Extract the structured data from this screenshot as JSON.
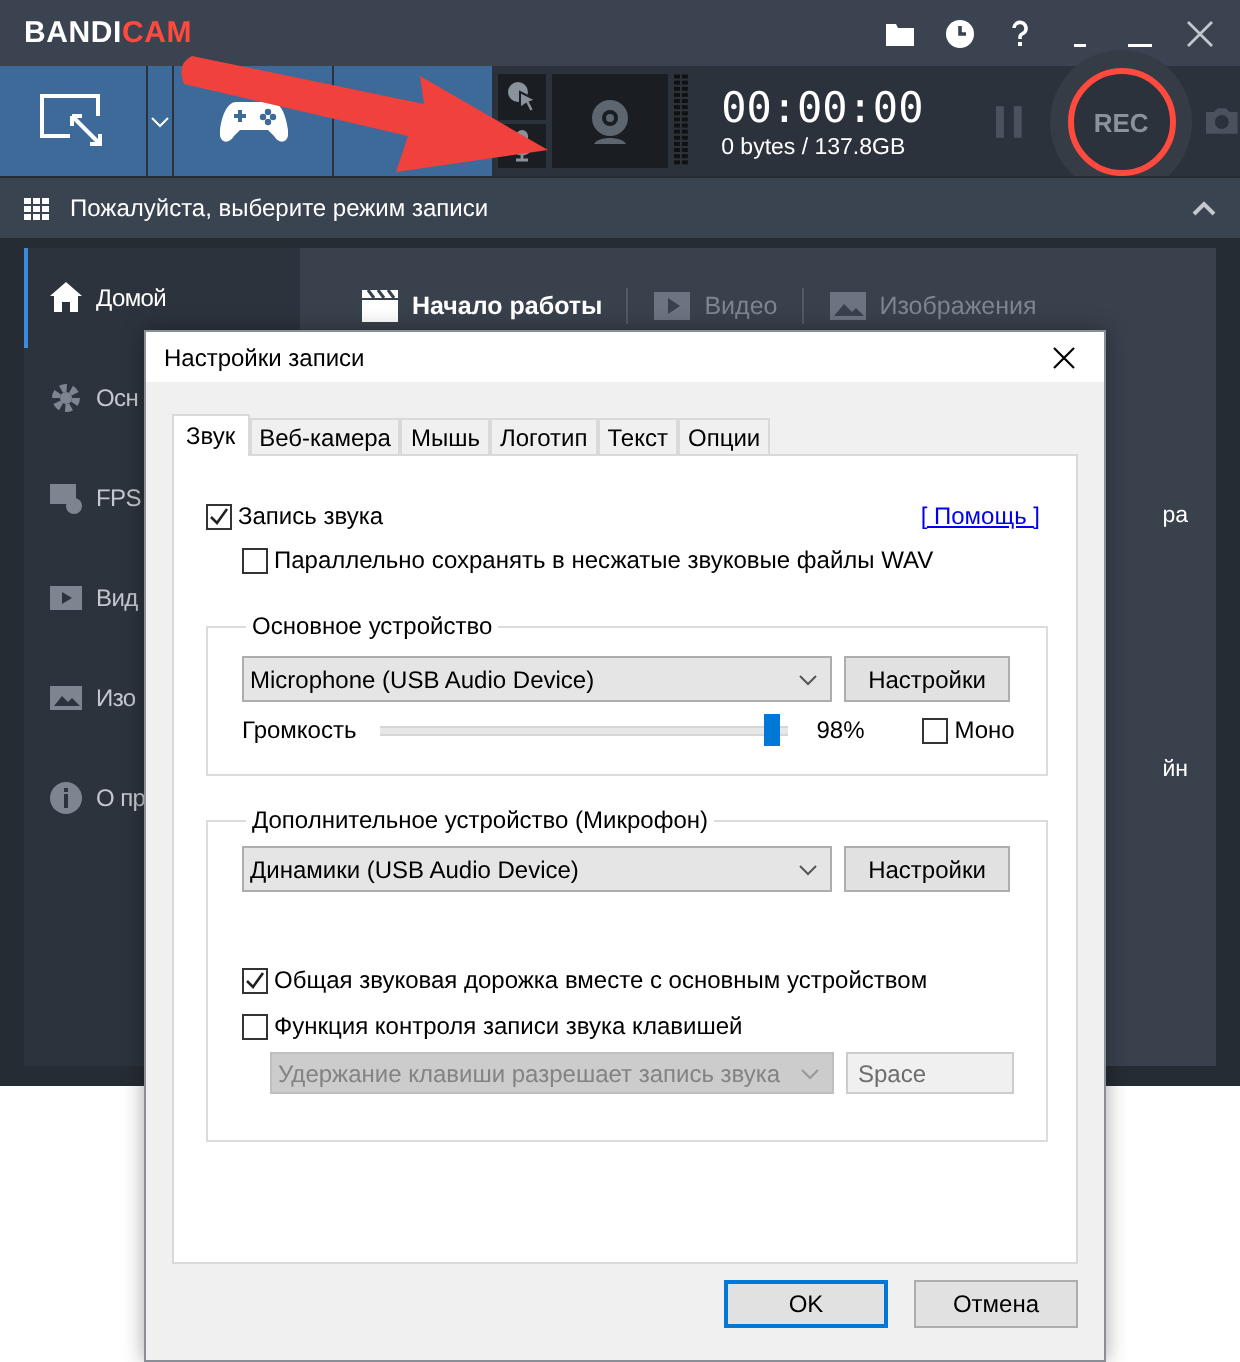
{
  "app": {
    "logo_left": "BANDI",
    "logo_right": "CAM",
    "timer": "00:00:00",
    "size": "0 bytes / 137.8GB",
    "rec": "REC",
    "mode_prompt": "Пожалуйста, выберите режим записи",
    "sidebar": [
      {
        "label": "Домой",
        "selected": true
      },
      {
        "label": "Осн",
        "selected": false
      },
      {
        "label": "FPS",
        "selected": false
      },
      {
        "label": "Вид",
        "selected": false
      },
      {
        "label": "Изо",
        "selected": false
      },
      {
        "label": "О пр",
        "selected": false
      }
    ],
    "content_tabs": [
      {
        "label": "Начало работы",
        "selected": true
      },
      {
        "label": "Видео",
        "selected": false
      },
      {
        "label": "Изображения",
        "selected": false
      }
    ],
    "panel_fragments": [
      "ра",
      "йн"
    ]
  },
  "dialog": {
    "title": "Настройки записи",
    "tabs": [
      {
        "label": "Звук",
        "selected": true
      },
      {
        "label": "Веб-камера",
        "selected": false
      },
      {
        "label": "Мышь",
        "selected": false
      },
      {
        "label": "Логотип",
        "selected": false
      },
      {
        "label": "Текст",
        "selected": false
      },
      {
        "label": "Опции",
        "selected": false
      }
    ],
    "record_sound": {
      "label": "Запись звука",
      "checked": true
    },
    "help_link": "[ Помощь ]",
    "wav": {
      "label": "Параллельно сохранять в несжатые звуковые файлы WAV",
      "checked": false
    },
    "primary": {
      "legend": "Основное устройство",
      "device": "Microphone (USB Audio Device)",
      "settings": "Настройки",
      "volume_label": "Громкость",
      "level": 0.98,
      "reading": "98%",
      "mono": {
        "label": "Моно",
        "checked": false
      }
    },
    "secondary": {
      "legend": "Дополнительное устройство (Микрофон)",
      "device": "Динамики (USB Audio Device)",
      "settings": "Настройки"
    },
    "shared_track": {
      "label": "Общая звуковая дорожка вместе с основным устройством",
      "checked": true
    },
    "hotkey": {
      "label": "Функция контроля записи звука клавишей",
      "checked": false
    },
    "hotkey_mode": {
      "value": "Удержание клавиши разрешает запись звука",
      "disabled": true
    },
    "hotkey_key": {
      "value": "Space",
      "disabled": true
    },
    "buttons": [
      {
        "label": "OK",
        "kind": "default"
      },
      {
        "label": "Отмена",
        "kind": "normal"
      }
    ]
  }
}
